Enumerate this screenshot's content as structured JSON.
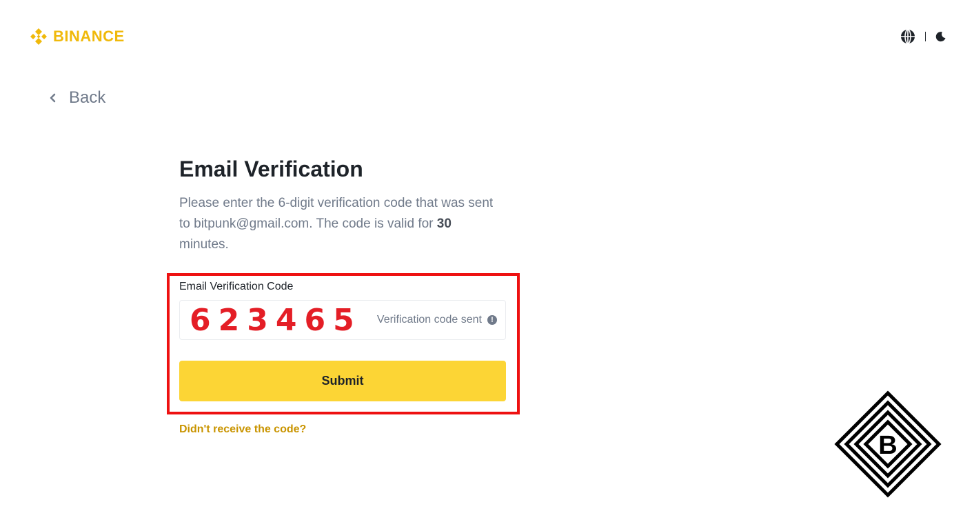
{
  "header": {
    "brand": "BINANCE",
    "brand_color": "#F0B90B",
    "icons": [
      "globe-icon",
      "moon-icon"
    ]
  },
  "back": {
    "label": "Back",
    "icon": "chevron-left-icon"
  },
  "form": {
    "title": "Email Verification",
    "description_part1": "Please enter the 6-digit verification code that was sent to bitpunk@gmail.com. The code is valid for ",
    "description_minutes": "30",
    "description_part2": " minutes.",
    "field_label": "Email Verification Code",
    "code_value": "623465",
    "code_color": "#E41E26",
    "status_text": "Verification code sent",
    "status_icon": "info-icon",
    "submit_label": "Submit",
    "submit_color": "#FCD535",
    "resend_link": "Didn't receive the code?"
  },
  "highlight_color": "#EE1111",
  "watermark": {
    "letter": "B"
  }
}
